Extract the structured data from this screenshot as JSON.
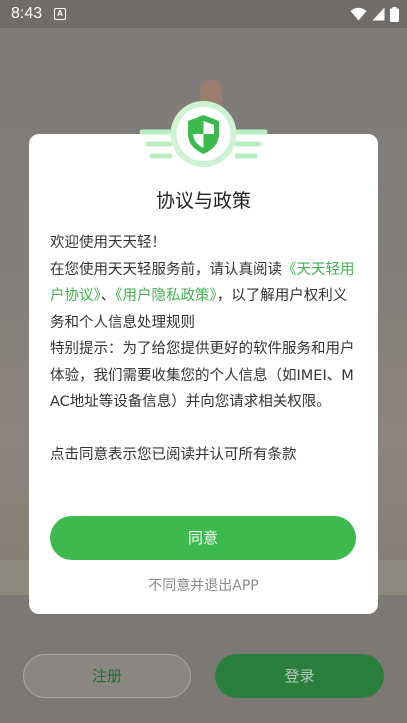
{
  "status_bar": {
    "time": "8:43",
    "app_icon_glyph": "A",
    "icons": [
      "wifi-icon",
      "cell-signal-icon",
      "battery-icon"
    ]
  },
  "dialog": {
    "title": "协议与政策",
    "greeting": "欢迎使用天天轻！",
    "intro_before": "在您使用天天轻服务前，请认真阅读",
    "link_user_agreement": "《天天轻用户协议》",
    "separator": "、",
    "link_privacy_policy": "《用户隐私政策》",
    "intro_after": "，以了解用户权利义务和个人信息处理规则",
    "notice": "特别提示：为了给您提供更好的软件服务和用户体验，我们需要收集您的个人信息（如IMEI、MAC地址等设备信息）并向您请求相关权限。",
    "consent": "点击同意表示您已阅读并认可所有条款",
    "agree_label": "同意",
    "decline_label": "不同意并退出APP",
    "badge_icon": "shield-icon"
  },
  "background": {
    "register_label": "注册",
    "login_label": "登录"
  },
  "colors": {
    "accent": "#3dba4e",
    "link": "#3fb34f"
  }
}
